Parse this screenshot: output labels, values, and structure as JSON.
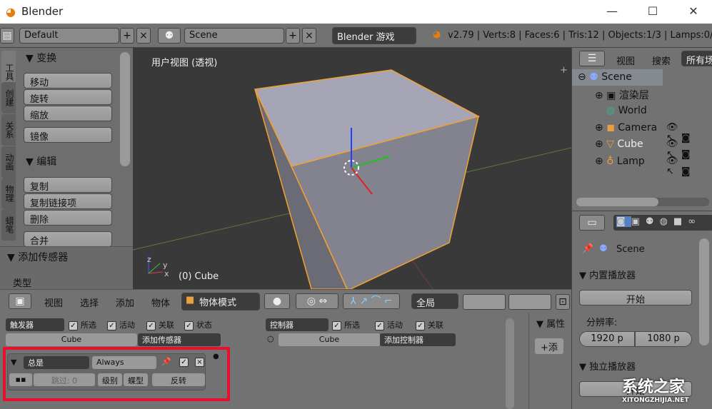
{
  "window": {
    "title": "Blender",
    "minimize": "—",
    "maximize": "☐",
    "close": "✕"
  },
  "header": {
    "layout": "Default",
    "scene": "Scene",
    "engine": "Blender 游戏",
    "stats": "v2.79 | Verts:8 | Faces:6 | Tris:12 | Objects:1/3 | Lamps:0/1"
  },
  "tools": {
    "tabs": [
      "工具",
      "创建",
      "关系",
      "动画",
      "物理",
      "蜡笔"
    ],
    "transform": {
      "title": "变换",
      "items": [
        "移动",
        "旋转",
        "缩放",
        "镜像"
      ]
    },
    "edit": {
      "title": "编辑",
      "items": [
        "复制",
        "复制链接项",
        "删除",
        "合并"
      ]
    },
    "add_sensor": {
      "title": "添加传感器",
      "type_label": "类型"
    }
  },
  "viewport": {
    "view_label": "用户视图 (透视)",
    "object_label": "(0) Cube",
    "axis_x": "x",
    "axis_y": "y",
    "axis_z": "z"
  },
  "viewport_header": {
    "menus": [
      "视图",
      "选择",
      "添加",
      "物体"
    ],
    "mode": "物体模式",
    "orientation": "全局"
  },
  "logic": {
    "sensors": {
      "dropdown": "触发器",
      "checks": [
        "所选",
        "活动",
        "关联",
        "状态"
      ],
      "object": "Cube",
      "add": "添加传感器"
    },
    "controllers": {
      "dropdown": "控制器",
      "checks": [
        "所选",
        "活动",
        "关联"
      ],
      "object": "Cube",
      "add": "添加控制器"
    },
    "sensor": {
      "type": "总是",
      "name": "Always",
      "skip_label": "跳过:",
      "skip_value": "0",
      "level": "级别",
      "tap": "蝶型",
      "invert": "反转"
    },
    "side": {
      "title": "属性",
      "add": "添"
    }
  },
  "outliner": {
    "menus": [
      "视图",
      "搜索"
    ],
    "filter": "所有场",
    "items": [
      "Scene",
      "渲染层",
      "World",
      "Camera",
      "Cube",
      "Lamp"
    ]
  },
  "properties": {
    "scene": "Scene",
    "embedded": {
      "title": "内置播放器",
      "start": "开始",
      "res_label": "分辨率:",
      "width": "1920 p",
      "height": "1080 p"
    },
    "standalone": {
      "title": "独立播放器",
      "start": "开始"
    }
  },
  "watermark": {
    "text": "系统之家",
    "url": "XITONGZHIJIA.NET"
  },
  "colors": {
    "highlight": "#e8112d",
    "selected_outline": "#f5a030",
    "accent": "#5680c2"
  }
}
